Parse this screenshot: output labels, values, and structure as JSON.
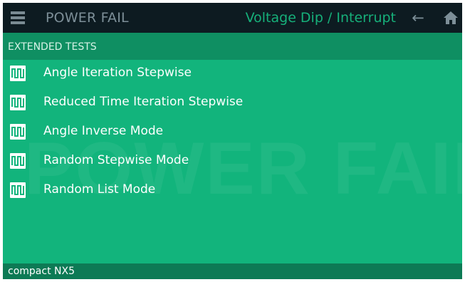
{
  "header": {
    "app_title": "POWER FAIL",
    "mode_title": "Voltage Dip / Interrupt",
    "back_glyph": "←",
    "icons": [
      "menu-icon",
      "back-arrow-icon",
      "home-icon"
    ]
  },
  "section": {
    "title": "EXTENDED TESTS"
  },
  "watermark": "POWER FAIL",
  "tests": [
    {
      "label": "Angle Iteration Stepwise",
      "icon": "square-wave-icon"
    },
    {
      "label": "Reduced Time Iteration Stepwise",
      "icon": "square-wave-icon"
    },
    {
      "label": "Angle Inverse Mode",
      "icon": "square-wave-icon"
    },
    {
      "label": "Random Stepwise Mode",
      "icon": "square-wave-icon"
    },
    {
      "label": "Random List Mode",
      "icon": "square-wave-icon"
    }
  ],
  "footer": {
    "device": "compact NX5"
  },
  "colors": {
    "background": "#12b47c",
    "topbar": "#0d1b21",
    "section_header": "#0f8f62",
    "footer": "#0d7a55",
    "accent": "#16b07a"
  }
}
